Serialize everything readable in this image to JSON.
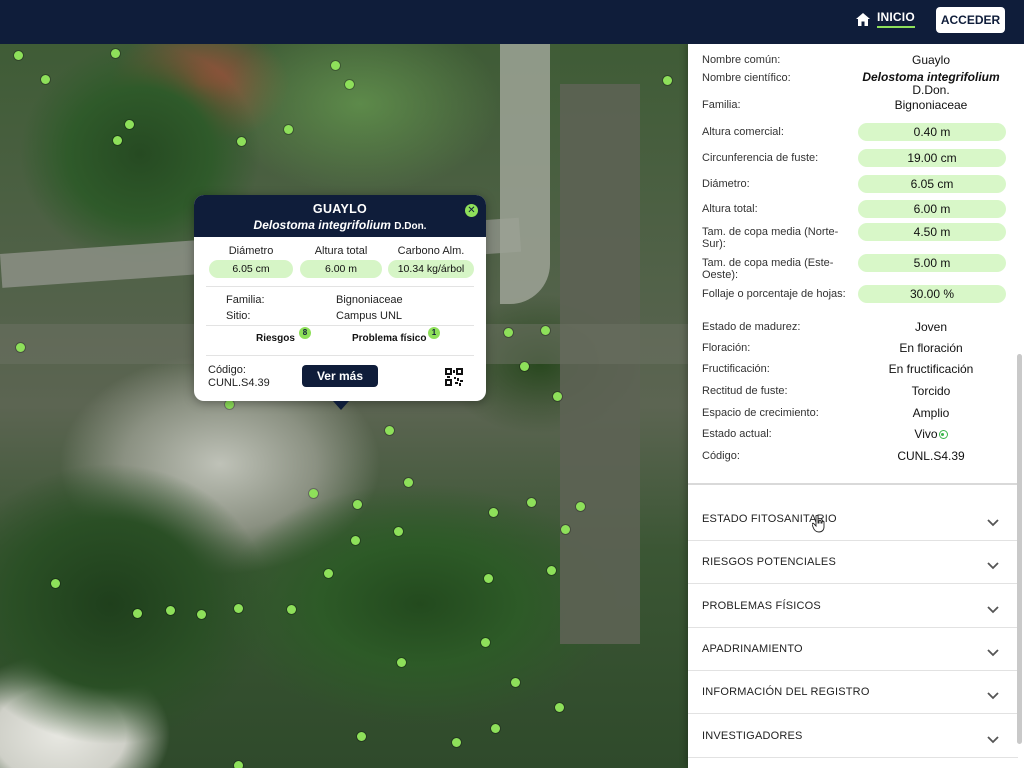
{
  "nav": {
    "home_label": "INICIO",
    "login_label": "ACCEDER"
  },
  "popup": {
    "title": "GUAYLO",
    "scientific_name": "Delostoma integrifolium",
    "author": "D.Don.",
    "metrics": [
      {
        "label": "Diámetro",
        "value": "6.05 cm"
      },
      {
        "label": "Altura total",
        "value": "6.00 m"
      },
      {
        "label": "Carbono Alm.",
        "value": "10.34 kg/árbol"
      }
    ],
    "info": [
      {
        "label": "Familia:",
        "value": "Bignoniaceae"
      },
      {
        "label": "Sitio:",
        "value": "Campus UNL"
      }
    ],
    "badges": [
      {
        "label": "Riesgos",
        "count": "8"
      },
      {
        "label": "Problema físico",
        "count": "1"
      }
    ],
    "code_label": "Código:",
    "code_value": "CUNL.S4.39",
    "more_button": "Ver más"
  },
  "panel": {
    "attributes": [
      {
        "label": "Nombre común:",
        "value": "Guaylo",
        "style": "plain"
      },
      {
        "label": "Nombre científico:",
        "value": "Delostoma integrifolium",
        "value2": "D.Don.",
        "style": "sci"
      },
      {
        "label": "Familia:",
        "value": "Bignoniaceae",
        "style": "plain"
      },
      {
        "label": "Altura comercial:",
        "value": "0.40 m",
        "style": "pill"
      },
      {
        "label": "Circunferencia de fuste:",
        "value": "19.00 cm",
        "style": "pill"
      },
      {
        "label": "Diámetro:",
        "value": "6.05 cm",
        "style": "pill"
      },
      {
        "label": "Altura total:",
        "value": "6.00 m",
        "style": "pill"
      },
      {
        "label": "Tam. de copa media (Norte-Sur):",
        "value": "4.50 m",
        "style": "pill"
      },
      {
        "label": "Tam. de copa media (Este-Oeste):",
        "value": "5.00 m",
        "style": "pill"
      },
      {
        "label": "Follaje o porcentaje de hojas:",
        "value": "30.00 %",
        "style": "pill"
      },
      {
        "label": "Estado de madurez:",
        "value": "Joven",
        "style": "plain"
      },
      {
        "label": "Floración:",
        "value": "En floración",
        "style": "plain"
      },
      {
        "label": "Fructificación:",
        "value": "En fructificación",
        "style": "plain"
      },
      {
        "label": "Rectitud de fuste:",
        "value": "Torcido",
        "style": "plain"
      },
      {
        "label": "Espacio de crecimiento:",
        "value": "Amplio",
        "style": "plain"
      },
      {
        "label": "Estado actual:",
        "value": "Vivo",
        "style": "status"
      },
      {
        "label": "Código:",
        "value": "CUNL.S4.39",
        "style": "plain"
      }
    ],
    "sections": [
      "ESTADO FITOSANITARIO",
      "RIESGOS POTENCIALES",
      "PROBLEMAS FÍSICOS",
      "APADRINAMIENTO",
      "INFORMACIÓN DEL REGISTRO",
      "INVESTIGADORES"
    ]
  },
  "colors": {
    "navy": "#0f1d3a",
    "accent_green": "#8ee05a",
    "pill_bg": "#d8f7c8",
    "status_green": "#3ab54a"
  },
  "icons": {
    "home": "home-icon",
    "close": "close-icon",
    "qr": "qr-code-icon",
    "chevron": "chevron-down-icon"
  }
}
